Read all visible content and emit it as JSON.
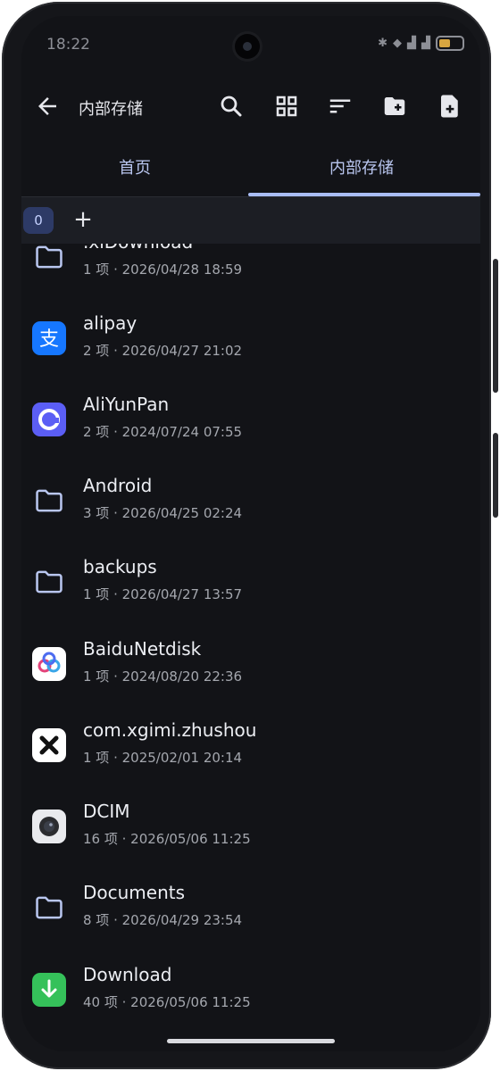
{
  "status_bar": {
    "time": "18:22",
    "icons": [
      "bluetooth-icon",
      "wifi-icon",
      "signal-icon",
      "signal-icon",
      "battery-icon"
    ]
  },
  "toolbar": {
    "title": "内部存储",
    "icons": [
      "back-arrow-icon",
      "search-icon",
      "grid-view-icon",
      "sort-icon",
      "new-folder-icon",
      "new-file-icon"
    ]
  },
  "tabs": [
    {
      "label": "首页",
      "selected": false
    },
    {
      "label": "内部存储",
      "selected": true
    }
  ],
  "path_bar": {
    "chip": "0",
    "add": "+"
  },
  "files": [
    {
      "name": ".xlDownload",
      "meta": "1 项 · 2026/04/28 18:59",
      "icon": "folder-icon"
    },
    {
      "name": "alipay",
      "meta": "2 项 · 2026/04/27 21:02",
      "icon": "alipay-app-icon"
    },
    {
      "name": "AliYunPan",
      "meta": "2 项 · 2024/07/24 07:55",
      "icon": "aliyunpan-app-icon"
    },
    {
      "name": "Android",
      "meta": "3 项 · 2026/04/25 02:24",
      "icon": "folder-icon"
    },
    {
      "name": "backups",
      "meta": "1 项 · 2026/04/27 13:57",
      "icon": "folder-icon"
    },
    {
      "name": "BaiduNetdisk",
      "meta": "1 项 · 2024/08/20 22:36",
      "icon": "baidu-netdisk-app-icon"
    },
    {
      "name": "com.xgimi.zhushou",
      "meta": "1 项 · 2025/02/01 20:14",
      "icon": "xgimi-app-icon"
    },
    {
      "name": "DCIM",
      "meta": "16 项 · 2026/05/06 11:25",
      "icon": "camera-app-icon"
    },
    {
      "name": "Documents",
      "meta": "8 项 · 2026/04/29 23:54",
      "icon": "folder-icon"
    },
    {
      "name": "Download",
      "meta": "40 项 · 2026/05/06 11:25",
      "icon": "download-app-icon"
    }
  ],
  "colors": {
    "background": "#121317",
    "accent": "#a9bdf5",
    "folder": "#b9c6ef",
    "text_primary": "#eceef3",
    "text_secondary": "#a4a7ae"
  }
}
